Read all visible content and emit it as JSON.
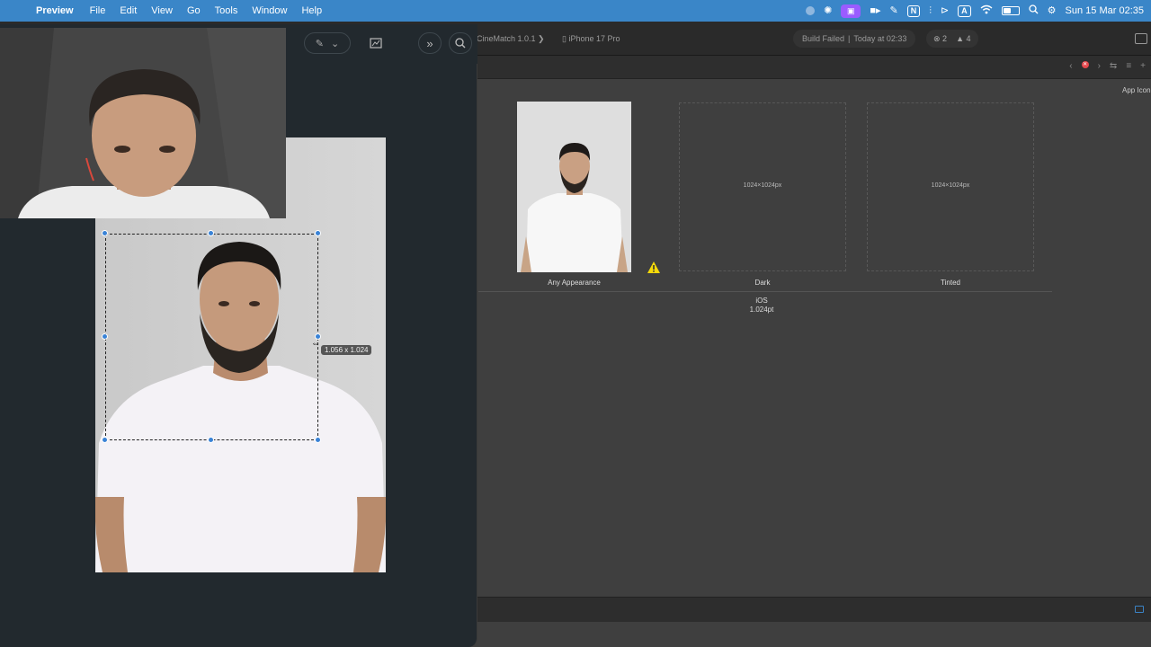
{
  "menubar": {
    "app_name": "Preview",
    "items": [
      "File",
      "Edit",
      "View",
      "Go",
      "Tools",
      "Window",
      "Help"
    ],
    "clock": "Sun 15 Mar  02:35",
    "status_icons": [
      "record-dot-icon",
      "chatgpt-icon",
      "screen-capture-icon",
      "video-camera-icon",
      "feather-icon",
      "notion-icon",
      "airpods-icon",
      "play-circle-icon",
      "keyboard-input-icon",
      "wifi-icon",
      "battery-icon",
      "search-icon",
      "control-center-icon"
    ],
    "notion_letter": "N",
    "input_letter": "A"
  },
  "xcode": {
    "scheme": "CineMatch 1.0.1",
    "device": "iPhone 17 Pro",
    "build_status": "Build Failed",
    "build_time": "Today at 02:33",
    "error_count": "2",
    "warning_count": "4",
    "inspector_title": "App Icon",
    "slots": [
      {
        "label": "Any Appearance",
        "size": ""
      },
      {
        "label": "Dark",
        "size": "1024×1024px"
      },
      {
        "label": "Tinted",
        "size": "1024×1024px"
      }
    ],
    "platform": "iOS",
    "platform_size": "1.024pt",
    "colors": {
      "error": "#e5484d",
      "warning": "#f5d90a"
    }
  },
  "preview": {
    "selection_size": "1.056 x 1.024",
    "accent": "#3a83d6"
  }
}
